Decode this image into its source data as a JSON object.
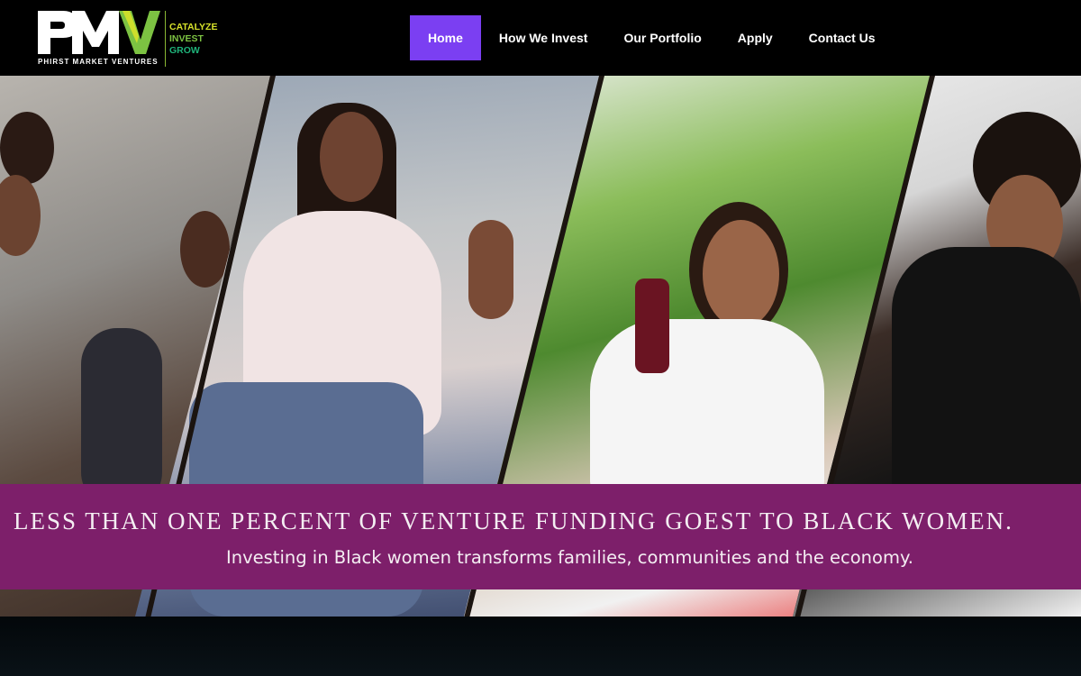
{
  "brand": {
    "logo_text": "PMV",
    "name": "PHIRST MARKET VENTURES",
    "tagline": [
      "CATALYZE",
      "INVEST",
      "GROW"
    ],
    "colors": {
      "accent_yellow": "#d6e12a",
      "accent_green": "#7cc242",
      "accent_teal": "#1fb37a"
    }
  },
  "nav": {
    "items": [
      {
        "label": "Home",
        "active": true
      },
      {
        "label": "How We Invest",
        "active": false
      },
      {
        "label": "Our Portfolio",
        "active": false
      },
      {
        "label": "Apply",
        "active": false
      },
      {
        "label": "Contact Us",
        "active": false
      }
    ],
    "active_color": "#7b3ff2"
  },
  "hero": {
    "headline": "LESS THAN ONE PERCENT OF VENTURE FUNDING GOEST TO BLACK WOMEN.",
    "subheadline": "Investing in Black women transforms families, communities and the economy.",
    "banner_color": "#7d1f6a",
    "panel_images": [
      "women-networking-photo",
      "woman-speaking-microphone-photo",
      "woman-holding-juice-photo",
      "woman-working-desk-photo"
    ]
  }
}
